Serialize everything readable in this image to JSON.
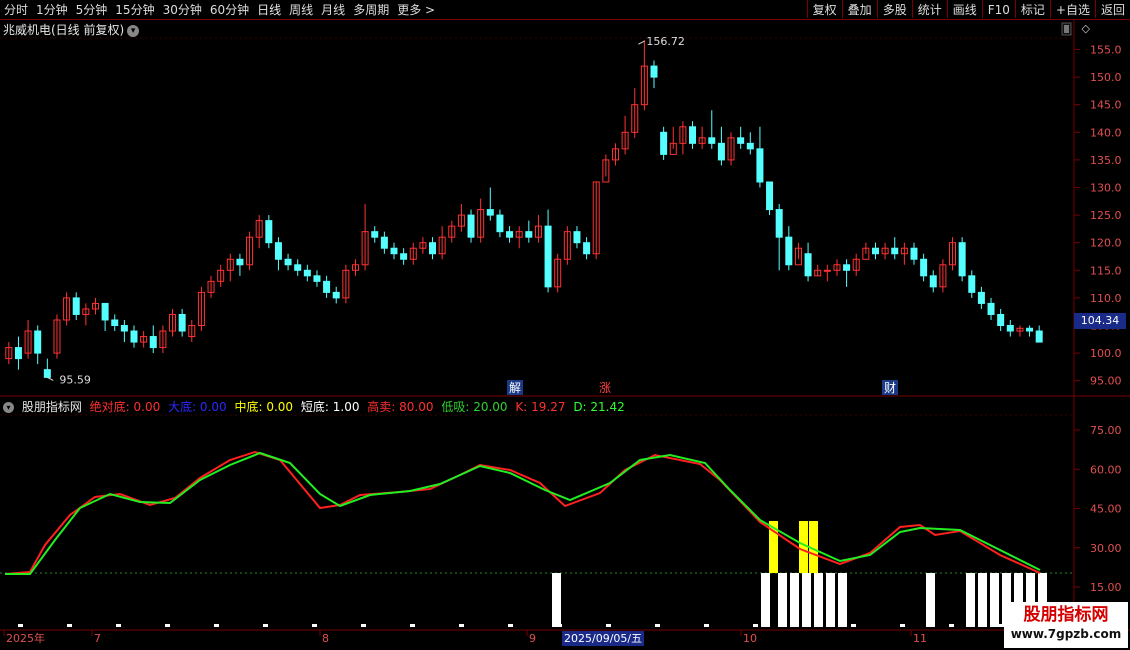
{
  "toolbar": {
    "periods": [
      "分时",
      "1分钟",
      "5分钟",
      "15分钟",
      "30分钟",
      "60分钟",
      "日线",
      "周线",
      "月线",
      "多周期",
      "更多 >"
    ],
    "active_period": "日线",
    "right_buttons": [
      "复权",
      "叠加",
      "多股",
      "统计",
      "画线",
      "F10",
      "标记",
      "+自选",
      "返回"
    ]
  },
  "main_chart": {
    "title": "兆威机电(日线 前复权)",
    "y_ticks": [
      "155.0",
      "150.0",
      "145.0",
      "140.0",
      "135.0",
      "130.0",
      "125.0",
      "120.0",
      "115.0",
      "110.0",
      "105.0",
      "100.0",
      "95.00"
    ],
    "high_label": "156.72",
    "low_label": "95.59",
    "last_price": "104.34",
    "markers": [
      "解",
      "涨",
      "财"
    ]
  },
  "indicator": {
    "name": "股朋指标网",
    "params": [
      {
        "label": "绝对底: 0.00",
        "color": "#ff3030"
      },
      {
        "label": "大底: 0.00",
        "color": "#2a2aff"
      },
      {
        "label": "中底: 0.00",
        "color": "#ffff00"
      },
      {
        "label": "短底: 1.00",
        "color": "#ffffff"
      },
      {
        "label": "高卖: 80.00",
        "color": "#ff3030"
      },
      {
        "label": "低吸: 20.00",
        "color": "#30d030"
      },
      {
        "label": "K: 19.27",
        "color": "#ff3030"
      },
      {
        "label": "D: 21.42",
        "color": "#30ff30"
      }
    ],
    "y_ticks": [
      "75.00",
      "60.00",
      "45.00",
      "30.00",
      "15.00"
    ]
  },
  "date_axis": {
    "labels": [
      "2025年",
      "7",
      "8",
      "9",
      "10",
      "11"
    ],
    "highlight": "2025/09/05/五"
  },
  "watermark": {
    "line1": "股朋指标网",
    "line2": "www.7gpzb.com"
  },
  "colors": {
    "up": "#ff3333",
    "down": "#55ffff",
    "grid": "#7a0000",
    "k": "#ff2020",
    "d": "#22ee22"
  }
}
